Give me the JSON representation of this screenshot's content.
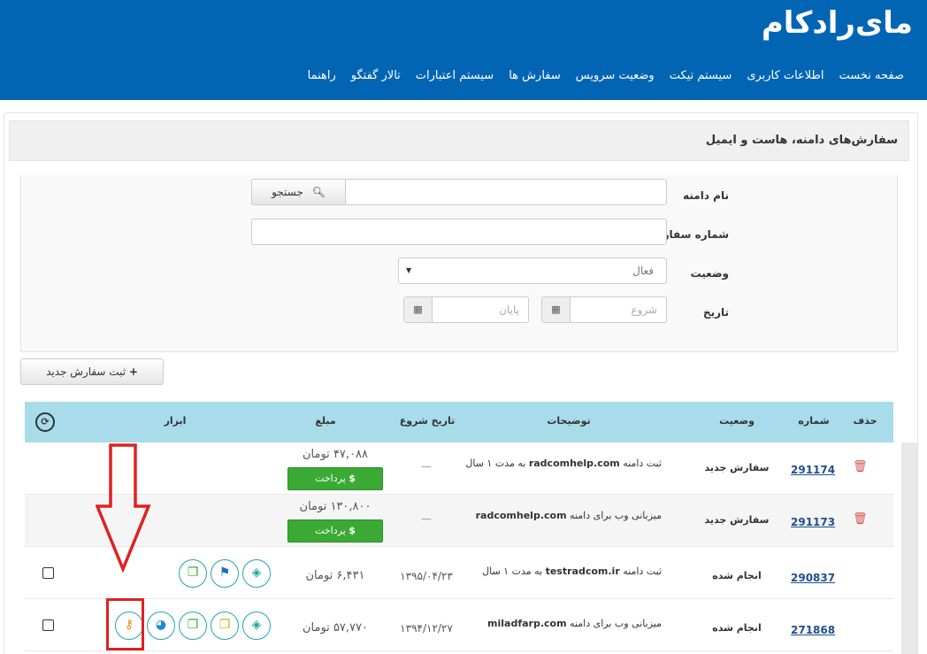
{
  "header": {
    "logo": "مای‌رادکام",
    "nav": [
      "صفحه نخست",
      "اطلاعات کاربری",
      "سیستم تیکت",
      "وضعیت سرویس",
      "سفارش ها",
      "سیستم اعتبارات",
      "تالار گفتگو",
      "راهنما"
    ]
  },
  "panel": {
    "title": "سفارش‌های دامنه، هاست و ایمیل"
  },
  "filters": {
    "domain_label": "نام دامنه",
    "search_button": "جستجو",
    "order_label": "شماره سفارش",
    "status_label": "وضعیت",
    "status_value": "فعال",
    "date_label": "تاریخ",
    "start_placeholder": "شروع",
    "end_placeholder": "پایان"
  },
  "new_order_button": "ثبت سفارش جدید",
  "table": {
    "headers": {
      "delete": "حذف",
      "number": "شماره",
      "status": "وضعیت",
      "desc": "توضیحات",
      "start": "تاریخ شروع",
      "amount": "مبلغ",
      "tools": "ابزار"
    },
    "pay_label": "پرداخت",
    "rows": [
      {
        "number": "291174",
        "status": "سفارش جدید",
        "desc_pre": "ثبت دامنه ",
        "desc_domain": "radcomhelp.com",
        "desc_post": " به مدت ۱ سال",
        "start": "—",
        "amount": "۴۷,۰۸۸ تومان"
      },
      {
        "number": "291173",
        "status": "سفارش جدید",
        "desc_pre": "میزبانی وب برای دامنه ",
        "desc_domain": "radcomhelp.com",
        "desc_post": "",
        "start": "—",
        "amount": "۱۳۰,۸۰۰ تومان"
      },
      {
        "number": "290837",
        "status": "انجام شده",
        "desc_pre": "ثبت دامنه ",
        "desc_domain": "testradcom.ir",
        "desc_post": " به مدت ۱ سال",
        "start": "۱۳۹۵/۰۴/۲۳",
        "amount": "۶,۴۳۱ تومان"
      },
      {
        "number": "271868",
        "status": "انجام شده",
        "desc_pre": "میزبانی وب برای دامنه ",
        "desc_domain": "miladfarp.com",
        "desc_post": "",
        "start": "۱۳۹۴/۱۲/۲۷",
        "amount": "۵۷,۷۷۰ تومان"
      }
    ]
  },
  "colors": {
    "header": "#0265b4",
    "table_head": "#a8dceb",
    "pay": "#3aaa35",
    "annotation": "#e02020",
    "tool_border": "#1fa7a7"
  }
}
